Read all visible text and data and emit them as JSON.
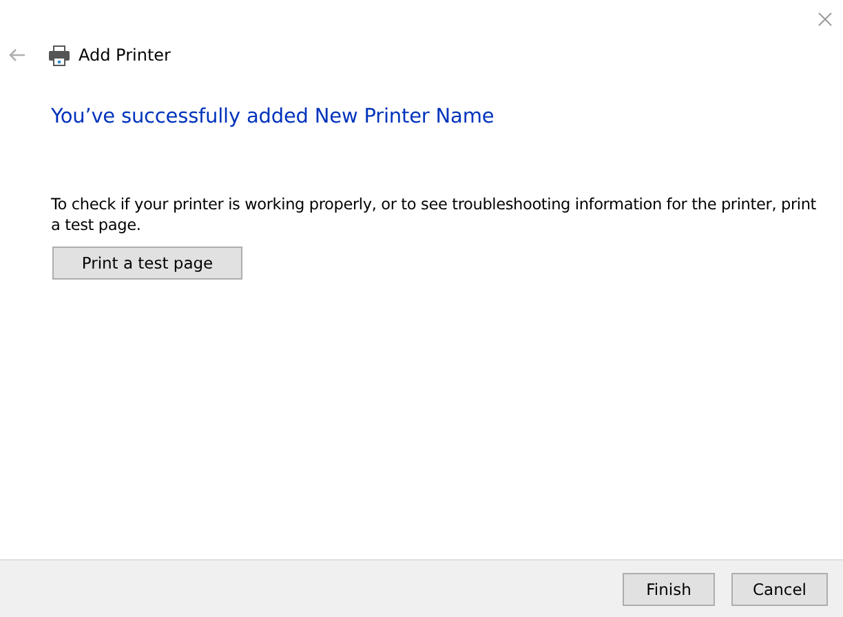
{
  "window": {
    "title": "Add Printer"
  },
  "heading": "You’ve successfully added New Printer Name",
  "description": "To check if your printer is working properly, or to see troubleshooting information for the printer, print a test page.",
  "test_button": "Print a test page",
  "buttons": [
    "Finish",
    "Cancel"
  ]
}
